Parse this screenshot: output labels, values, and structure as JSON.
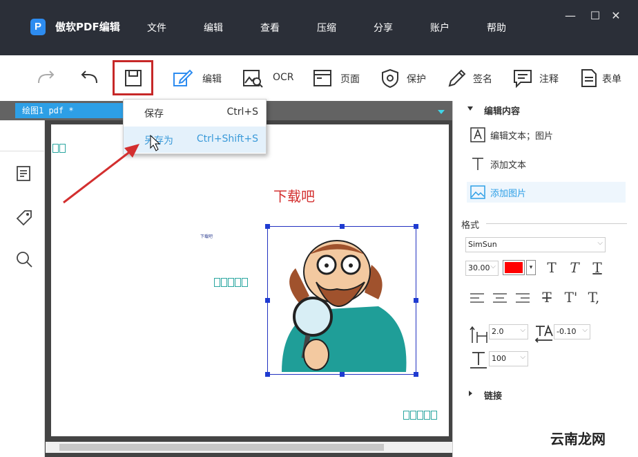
{
  "app": {
    "name": "傲软PDF编辑",
    "logo_letter": "P",
    "brand_color": "#2d8cf0"
  },
  "menu": [
    "文件",
    "编辑",
    "查看",
    "压缩",
    "分享",
    "账户",
    "帮助"
  ],
  "window_controls": {
    "minimize": "—",
    "maximize": "☐",
    "close": "✕"
  },
  "toolbar": {
    "tools": [
      {
        "label": "编辑",
        "icon": "edit-icon"
      },
      {
        "label": "OCR",
        "icon": "ocr-icon"
      },
      {
        "label": "页面",
        "icon": "page-icon"
      },
      {
        "label": "保护",
        "icon": "shield-icon"
      },
      {
        "label": "签名",
        "icon": "pen-icon"
      },
      {
        "label": "注释",
        "icon": "comment-icon"
      },
      {
        "label": "表单",
        "icon": "form-icon"
      }
    ],
    "highlight_color": "#c62828"
  },
  "document": {
    "tab_title": "绘图1 pdf *",
    "heading": "下载吧",
    "tiny_text": "下载吧"
  },
  "save_menu": {
    "items": [
      {
        "label": "保存",
        "shortcut": "Ctrl+S"
      },
      {
        "label": "另存为",
        "shortcut": "Ctrl+Shift+S"
      }
    ]
  },
  "panel": {
    "edit_section": "编辑内容",
    "items": [
      "编辑文本；图片",
      "添加文本",
      "添加图片"
    ],
    "format_label": "格式",
    "font": "SimSun",
    "font_size": "30.00",
    "text_color": "#ff0000",
    "line_spacing": "2.0",
    "char_spacing": "-0.10",
    "scale": "100",
    "link_section": "链接"
  },
  "watermark": "云南龙网"
}
